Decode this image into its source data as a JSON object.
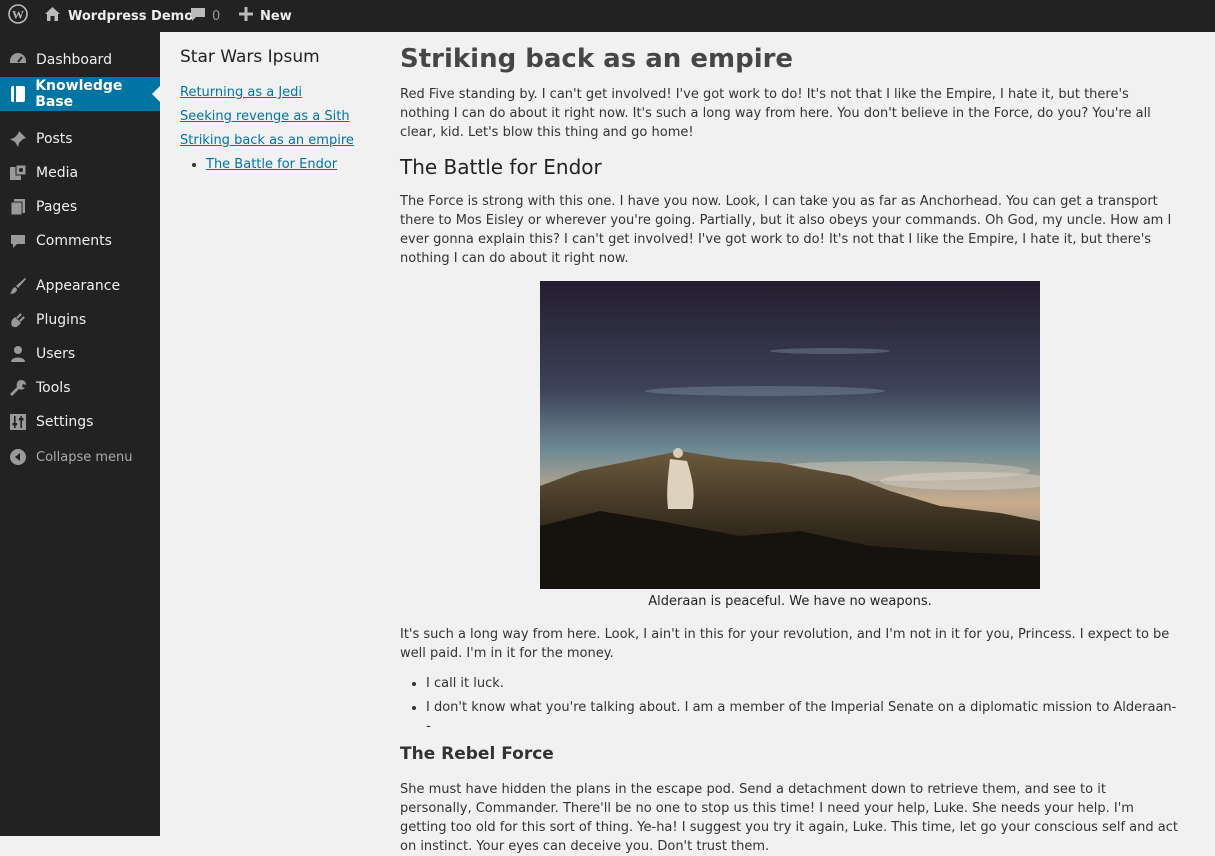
{
  "admin_bar": {
    "site_name": "Wordpress Demo",
    "comments_count": "0",
    "new_label": "New",
    "icons": {
      "wp": "wordpress-logo-icon",
      "home": "home-icon",
      "comments": "comment-bubble-icon",
      "new": "plus-icon"
    }
  },
  "menu": {
    "items": [
      {
        "label": "Dashboard",
        "icon": "dashboard-gauge-icon"
      },
      {
        "label": "Knowledge Base",
        "icon": "book-icon",
        "current": true
      },
      {
        "label": "Posts",
        "icon": "pushpin-icon"
      },
      {
        "label": "Media",
        "icon": "media-icon"
      },
      {
        "label": "Pages",
        "icon": "pages-icon"
      },
      {
        "label": "Comments",
        "icon": "comments-icon"
      },
      {
        "label": "Appearance",
        "icon": "paintbrush-icon"
      },
      {
        "label": "Plugins",
        "icon": "plug-icon"
      },
      {
        "label": "Users",
        "icon": "user-icon"
      },
      {
        "label": "Tools",
        "icon": "wrench-icon"
      },
      {
        "label": "Settings",
        "icon": "sliders-icon"
      }
    ],
    "collapse_label": "Collapse menu"
  },
  "sidebar": {
    "title": "Star Wars Ipsum",
    "links": [
      "Returning as a Jedi",
      "Seeking revenge as a Sith",
      "Striking back as an empire"
    ],
    "sub_links": [
      "The Battle for Endor"
    ]
  },
  "article": {
    "title": "Striking back as an empire",
    "intro": "Red Five standing by. I can't get involved! I've got work to do! It's not that I like the Empire, I hate it, but there's nothing I can do about it right now. It's such a long way from here. You don't believe in the Force, do you? You're all clear, kid. Let's blow this thing and go home!",
    "section1_title": "The Battle for Endor",
    "section1_text": "The Force is strong with this one. I have you now. Look, I can take you as far as Anchorhead. You can get a transport there to Mos Eisley or wherever you're going. Partially, but it also obeys your commands. Oh God, my uncle. How am I ever gonna explain this? I can't get involved! I've got work to do! It's not that I like the Empire, I hate it, but there's nothing I can do about it right now.",
    "image_caption": "Alderaan is peaceful. We have no weapons.",
    "paragraph3": "It's such a long way from here. Look, I ain't in this for your revolution, and I'm not in it for you, Princess. I expect to be well paid. I'm in it for the money.",
    "list": [
      "I call it luck.",
      "I don't know what you're talking about. I am a member of the Imperial Senate on a diplomatic mission to Alderaan--"
    ],
    "section2_title": "The Rebel Force",
    "section2_text": "She must have hidden the plans in the escape pod. Send a detachment down to retrieve them, and see to it personally, Commander. There'll be no one to stop us this time! I need your help, Luke. She needs your help. I'm getting too old for this sort of thing. Ye-ha! I suggest you try it again, Luke. This time, let go your conscious self and act on instinct. Your eyes can deceive you. Don't trust them."
  },
  "colors": {
    "admin_bar": "#222222",
    "menu_bg": "#222222",
    "accent": "#0074a2",
    "page_bg": "#f1f1f1"
  }
}
